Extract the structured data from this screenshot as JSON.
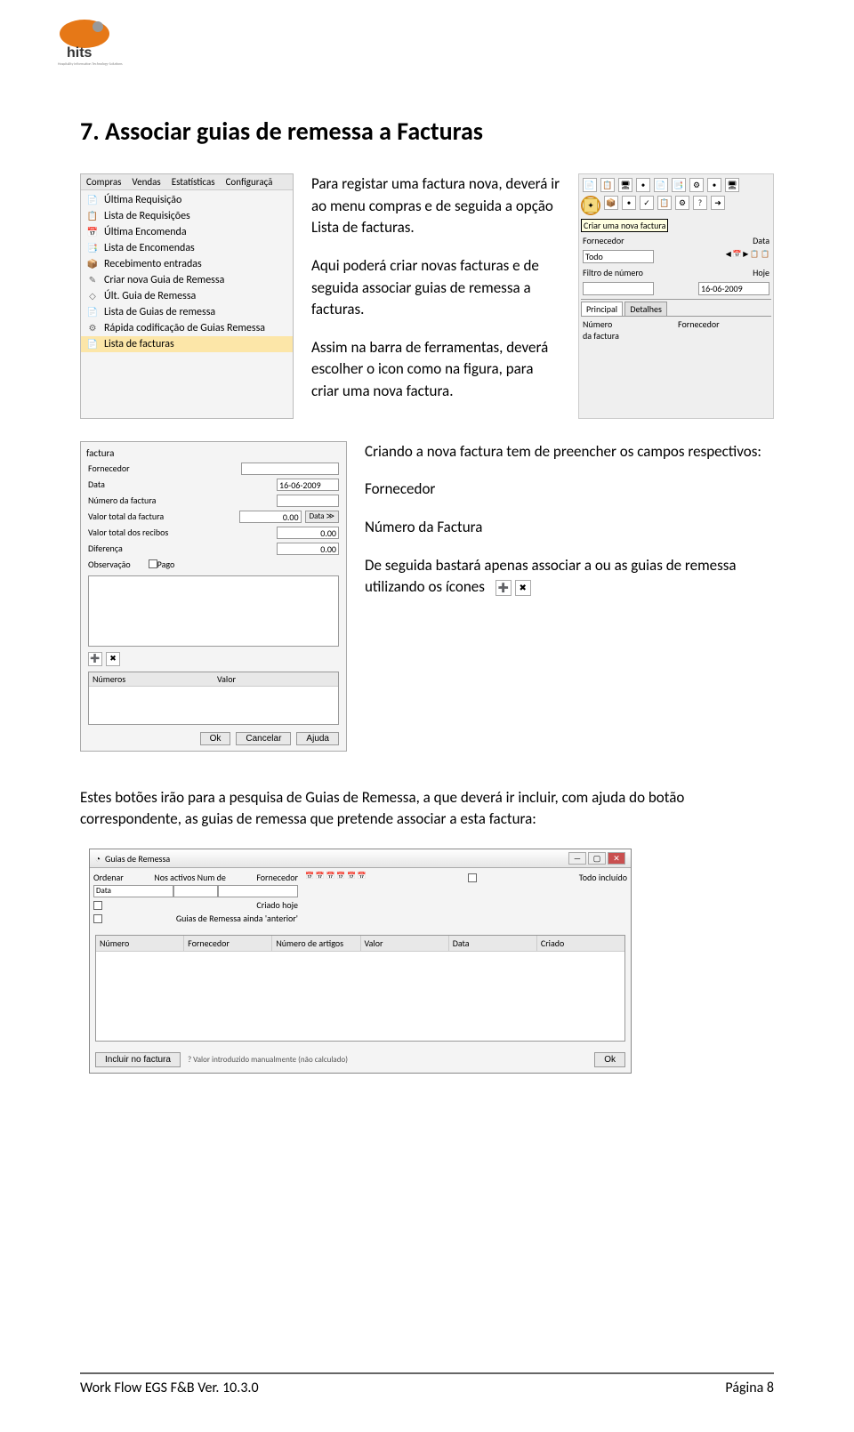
{
  "logo_alt": "hits — Hospitality Information Technology Solutions",
  "heading": "7. Associar guias de remessa a Facturas",
  "menu": {
    "bar": [
      "Compras",
      "Vendas",
      "Estatísticas",
      "Configuraçã"
    ],
    "items": [
      {
        "icon": "📄",
        "label": "Última Requisição"
      },
      {
        "icon": "📋",
        "label": "Lista de Requisições"
      },
      {
        "icon": "📅",
        "label": "Última Encomenda"
      },
      {
        "icon": "📑",
        "label": "Lista de Encomendas"
      },
      {
        "icon": "📦",
        "label": "Recebimento entradas"
      },
      {
        "icon": "✎",
        "label": "Criar nova Guia de Remessa"
      },
      {
        "icon": "◇",
        "label": "Últ. Guia de Remessa"
      },
      {
        "icon": "📄",
        "label": "Lista de Guias de remessa"
      },
      {
        "icon": "⚙",
        "label": "Rápida codificação de Guias Remessa"
      },
      {
        "icon": "📄",
        "label": "Lista de facturas"
      }
    ],
    "selected_index": 9
  },
  "para1": "Para registar uma factura nova, deverá ir ao menu compras e de seguida a opção Lista de facturas.",
  "para2": "Aqui poderá criar novas facturas e de seguida associar guias de remessa a facturas.",
  "para3": "Assim na barra de ferramentas, deverá escolher o icon como na figura, para criar uma nova factura.",
  "toolbar": {
    "tooltip": "Criar uma nova factura",
    "fornecedor_label": "Fornecedor",
    "fornecedor_value": "Todo",
    "data_label": "Data",
    "filtro_label": "Filtro de número",
    "hoje_label": "Hoje",
    "hoje_value": "16-06-2009",
    "tabs": [
      "Principal",
      "Detalhes"
    ],
    "col1": "Número\nda factura",
    "col2": "Fornecedor"
  },
  "form": {
    "title": "factura",
    "fornecedor": "Fornecedor",
    "data": "Data",
    "data_value": "16-06-2009",
    "numero": "Número da factura",
    "valor_total": "Valor total da factura",
    "valor_total_val": "0.00",
    "btn_data": "Data ≫",
    "valor_recibos": "Valor total dos recibos",
    "valor_recibos_val": "0.00",
    "diferenca": "Diferença",
    "diferenca_val": "0.00",
    "observacao": "Observação",
    "pago": "Pago",
    "numeros": "Números",
    "valor": "Valor",
    "btn_ok": "Ok",
    "btn_cancel": "Cancelar",
    "btn_ajuda": "Ajuda"
  },
  "para4": "Criando a nova factura tem de preencher os campos respectivos:",
  "para5": "Fornecedor",
  "para6": "Número da Factura",
  "para7": "De seguida bastará apenas associar a ou as guias de remessa utilizando os ícones",
  "para8": "Estes botões irão para a pesquisa de Guias de Remessa, a que deverá ir incluir, com ajuda do botão correspondente, as guias de remessa que pretende associar a esta factura:",
  "guias": {
    "title": "Guias de Remessa",
    "ordenar": "Ordenar",
    "ordenar_value": "Data",
    "nos_activos": "Nos activos Num de",
    "fornecedor": "Fornecedor",
    "criado_hoje": "Criado hoje",
    "guias_anteriores": "Guias de Remessa ainda 'anterior'",
    "todo_incluido": "Todo incluído",
    "cols": [
      "Número",
      "Fornecedor",
      "Número de artigos",
      "Valor",
      "Data",
      "Criado"
    ],
    "btn_incluir": "Incluir no factura",
    "note": "? Valor introduzido manualmente (não calculado)",
    "btn_ok": "Ok"
  },
  "footer_left": "Work Flow EGS F&B Ver. 10.3.0",
  "footer_right": "Página 8"
}
